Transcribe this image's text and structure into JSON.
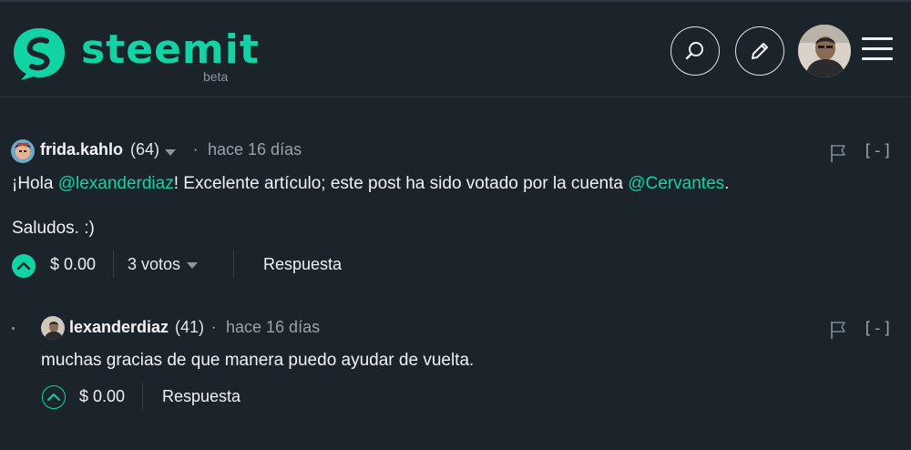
{
  "header": {
    "brand": "steemit",
    "beta_label": "beta",
    "brand_color": "#12d3a3",
    "icons": [
      "search-icon",
      "pencil-icon",
      "user-avatar",
      "hamburger-menu-icon"
    ]
  },
  "comments": [
    {
      "author": "frida.kahlo",
      "reputation": "(64)",
      "separator": "·",
      "time": "hace 16 días",
      "collapse": "[-]",
      "body": {
        "prefix": "¡Hola ",
        "mention1": "@lexanderdiaz",
        "middle": "! Excelente artículo; este post ha sido votado por la cuenta ",
        "mention2": "@Cervantes",
        "suffix": "."
      },
      "body2": "Saludos. :)",
      "payout": "$ 0.00",
      "votes": "3 votos",
      "reply": "Respuesta"
    },
    {
      "author": "lexanderdiaz",
      "reputation": "(41)",
      "separator": "·",
      "time": "hace 16 días",
      "collapse": "[-]",
      "body": "muchas gracias de que manera puedo ayudar de vuelta.",
      "payout": "$ 0.00",
      "reply": "Respuesta"
    }
  ]
}
